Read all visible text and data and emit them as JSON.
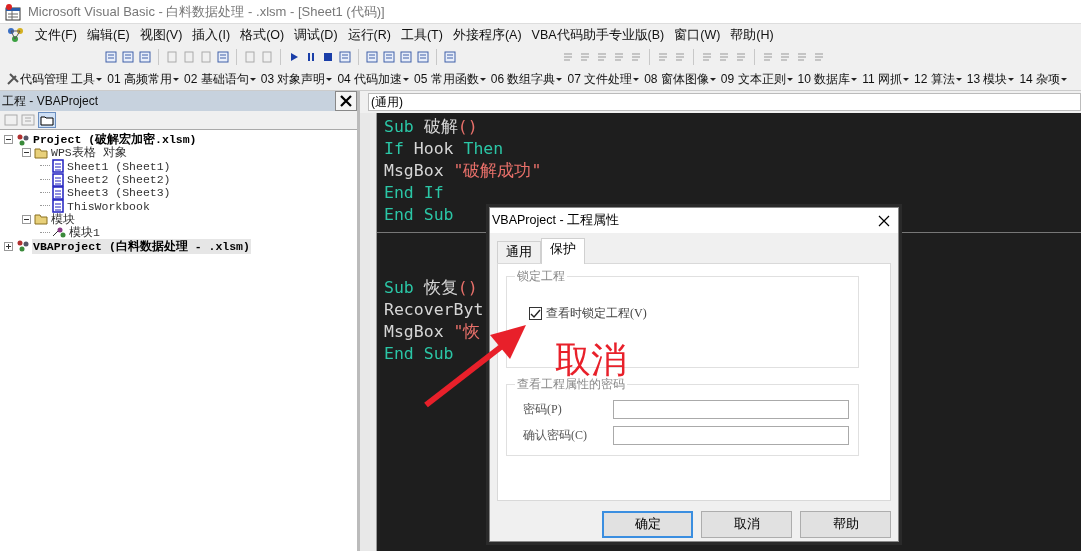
{
  "window": {
    "title": "Microsoft Visual Basic - 白料数据处理 - .xlsm - [Sheet1 (代码)]"
  },
  "menu": [
    "文件(F)",
    "编辑(E)",
    "视图(V)",
    "插入(I)",
    "格式(O)",
    "调试(D)",
    "运行(R)",
    "工具(T)",
    "外接程序(A)",
    "VBA代码助手专业版(B)",
    "窗口(W)",
    "帮助(H)"
  ],
  "addin_toolbar": [
    "代码管理 工具",
    "01 高频常用",
    "02 基础语句",
    "03 对象声明",
    "04 代码加速",
    "05 常用函数",
    "06 数组字典",
    "07 文件处理",
    "08 窗体图像",
    "09 文本正则",
    "10 数据库",
    "11 网抓",
    "12 算法",
    "13 模块",
    "14 杂项"
  ],
  "project_panel": {
    "title": "工程 - VBAProject",
    "tree": [
      {
        "label": "Project (破解宏加密.xlsm)",
        "kind": "project",
        "expanded": true,
        "selected": false,
        "children": [
          {
            "label": "WPS表格 对象",
            "kind": "folder",
            "expanded": true,
            "selected": false,
            "children": [
              {
                "label": "Sheet1 (Sheet1)",
                "kind": "sheet",
                "selected": false
              },
              {
                "label": "Sheet2 (Sheet2)",
                "kind": "sheet",
                "selected": false
              },
              {
                "label": "Sheet3 (Sheet3)",
                "kind": "sheet",
                "selected": false
              },
              {
                "label": "ThisWorkbook",
                "kind": "sheet",
                "selected": false
              }
            ]
          },
          {
            "label": "模块",
            "kind": "folder",
            "expanded": true,
            "selected": false,
            "children": [
              {
                "label": "模块1",
                "kind": "module",
                "selected": false
              }
            ]
          }
        ]
      },
      {
        "label": "VBAProject (白料数据处理 - .xlsm)",
        "kind": "project",
        "expanded": false,
        "selected": true
      }
    ]
  },
  "code_window": {
    "object_box": "(通用)",
    "procedures": [
      {
        "lines": [
          [
            {
              "kind": "keyword",
              "text": "Sub "
            },
            {
              "kind": "plain",
              "text": "破解"
            },
            {
              "kind": "string",
              "text": "()"
            }
          ],
          [
            {
              "kind": "keyword",
              "text": "If "
            },
            {
              "kind": "plain",
              "text": "Hook "
            },
            {
              "kind": "keyword",
              "text": "Then"
            }
          ],
          [
            {
              "kind": "plain",
              "text": "MsgBox "
            },
            {
              "kind": "string",
              "text": "\"破解成功\""
            }
          ],
          [
            {
              "kind": "keyword",
              "text": "End If"
            }
          ],
          [
            {
              "kind": "keyword",
              "text": "End Sub"
            }
          ]
        ]
      },
      {
        "lines": [
          [
            {
              "kind": "keyword",
              "text": "Sub "
            },
            {
              "kind": "plain",
              "text": "恢复"
            },
            {
              "kind": "string",
              "text": "()"
            }
          ],
          [
            {
              "kind": "plain",
              "text": "RecoverByt"
            }
          ],
          [
            {
              "kind": "plain",
              "text": "MsgBox "
            },
            {
              "kind": "string",
              "text": "\"恢"
            }
          ],
          [
            {
              "kind": "keyword",
              "text": "End Sub"
            }
          ]
        ]
      }
    ]
  },
  "dialog": {
    "title": "VBAProject - 工程属性",
    "tabs": [
      {
        "label": "通用",
        "selected": false
      },
      {
        "label": "保护",
        "selected": true
      }
    ],
    "lock_group": {
      "legend": "锁定工程",
      "checkbox": {
        "label": "查看时锁定工程(V)",
        "checked": true
      }
    },
    "password_group": {
      "legend": "查看工程属性的密码",
      "fields": [
        {
          "label": "密码(P)"
        },
        {
          "label": "确认密码(C)"
        }
      ]
    },
    "buttons": [
      {
        "label": "确定",
        "default": true
      },
      {
        "label": "取消",
        "default": false
      },
      {
        "label": "帮助",
        "default": false
      }
    ]
  },
  "annotation": {
    "text": "取消"
  }
}
